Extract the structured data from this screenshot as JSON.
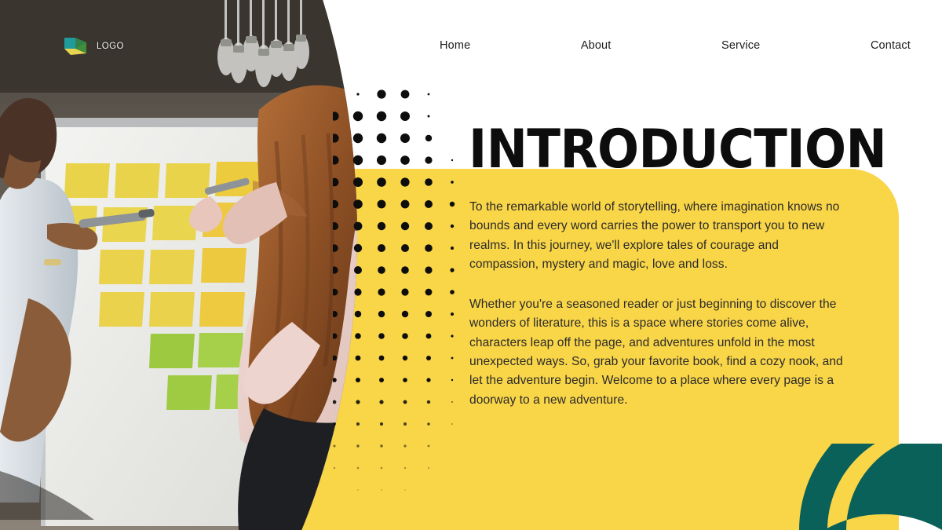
{
  "brand": {
    "logo_icon": "cube-logo-icon",
    "label": "LOGO",
    "colors": {
      "teal": "#0A6159",
      "green": "#4E9A3A",
      "yellow": "#F9D548"
    }
  },
  "nav": {
    "items": [
      {
        "label": "Home"
      },
      {
        "label": "About"
      },
      {
        "label": "Service"
      },
      {
        "label": "Contact"
      }
    ]
  },
  "main": {
    "title": "INTRODUCTION",
    "paragraphs": [
      "To the remarkable world of storytelling, where imagination knows no bounds and every word carries the power to transport you to new realms. In this journey, we'll explore tales of courage and compassion, mystery and magic, love and loss.",
      "Whether you're a seasoned reader or just beginning to discover the wonders of literature, this is a space where stories come alive, characters leap off the page, and adventures unfold in the most unexpected ways. So, grab your favorite book, find a cozy nook, and let the adventure begin. Welcome to a place where every page is a doorway to a new adventure."
    ]
  },
  "photo": {
    "alt": "Two colleagues standing at a whiteboard covered in yellow and green sticky notes, writing with markers in a workshop space",
    "icon": "workshop-photo"
  },
  "decor": {
    "halftone_dots_icon": "halftone-dot-grid",
    "teal_arc_icon": "teal-arc-shape",
    "panel_color": "#F9D548",
    "accent_color": "#0A6159",
    "title_color": "#0D0D0D",
    "body_text_color": "#2B2B2B"
  }
}
